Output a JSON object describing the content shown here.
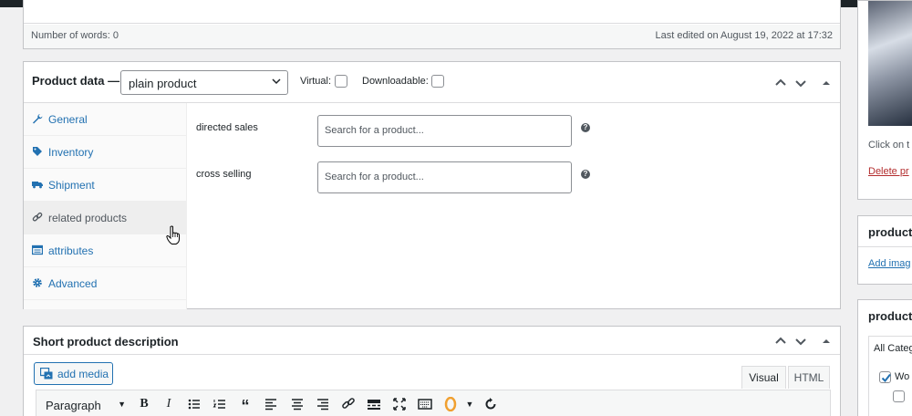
{
  "editor": {
    "word_count_label": "Number of words:",
    "word_count": "0",
    "last_edited": "Last edited on August 19, 2022 at 17:32"
  },
  "product_data": {
    "title": "Product data —",
    "type_selected": "plain product",
    "virtual_label": "Virtual:",
    "downloadable_label": "Downloadable:",
    "tabs": [
      {
        "label": "General",
        "icon": "wrench-icon"
      },
      {
        "label": "Inventory",
        "icon": "tag-icon"
      },
      {
        "label": "Shipment",
        "icon": "truck-icon"
      },
      {
        "label": "related products",
        "icon": "link-icon",
        "active": true
      },
      {
        "label": "attributes",
        "icon": "table-icon"
      },
      {
        "label": "Advanced",
        "icon": "gear-icon"
      }
    ],
    "fields": [
      {
        "label": "directed sales",
        "placeholder": "Search for a product..."
      },
      {
        "label": "cross selling",
        "placeholder": "Search for a product..."
      }
    ]
  },
  "short_description": {
    "title": "Short product description",
    "add_media": "add media",
    "tab_visual": "Visual",
    "tab_html": "HTML",
    "format": "Paragraph"
  },
  "sidebar": {
    "image_caption": "Click on t",
    "delete_link": "Delete pr",
    "gallery_title": "product",
    "gallery_link": "Add imag",
    "categories_title": "product",
    "categories_tab": "All Categ",
    "category_item": "Wo"
  }
}
